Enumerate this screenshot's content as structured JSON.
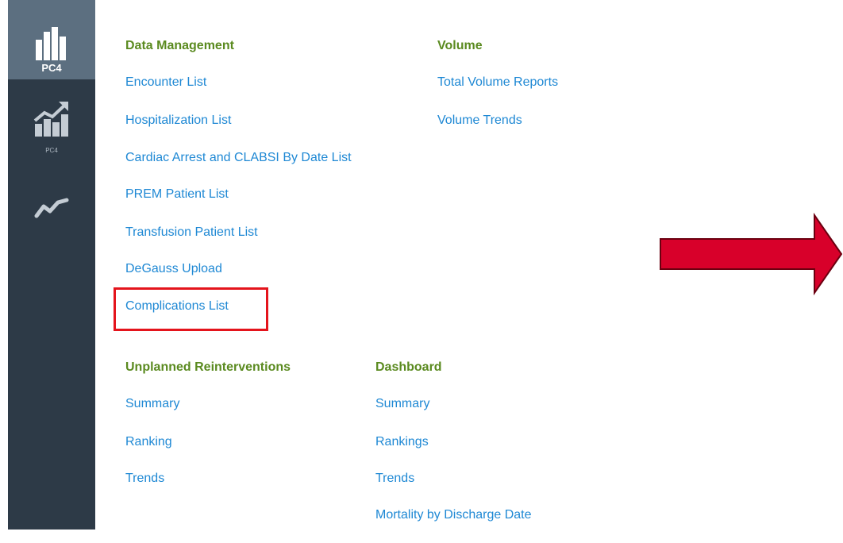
{
  "sidebar": {
    "items": [
      {
        "label": "PC4",
        "icon": "bar-chart-icon",
        "active": true
      },
      {
        "label": "PC4",
        "icon": "trend-chart-icon",
        "active": false
      },
      {
        "label": "",
        "icon": "line-trend-icon",
        "active": false
      }
    ]
  },
  "data_management": {
    "title": "Data Management",
    "links": [
      "Encounter List",
      "Hospitalization List",
      "Cardiac Arrest and CLABSI By Date List",
      "PREM Patient List",
      "Transfusion Patient List",
      "DeGauss Upload",
      "Complications List"
    ]
  },
  "volume": {
    "title": "Volume",
    "links": [
      "Total Volume Reports",
      "Volume Trends"
    ]
  },
  "unplanned": {
    "title": "Unplanned Reinterventions",
    "links": [
      "Summary",
      "Ranking",
      "Trends"
    ]
  },
  "dashboard": {
    "title": "Dashboard",
    "links": [
      "Summary",
      "Rankings",
      "Trends",
      "Mortality by Discharge Date"
    ]
  },
  "colors": {
    "section_title": "#5a8a1f",
    "link": "#1e88d4",
    "sidebar": "#2d3a47",
    "sidebar_active": "#5c6f80",
    "highlight": "#e4141c",
    "arrow": "#d8002a"
  }
}
